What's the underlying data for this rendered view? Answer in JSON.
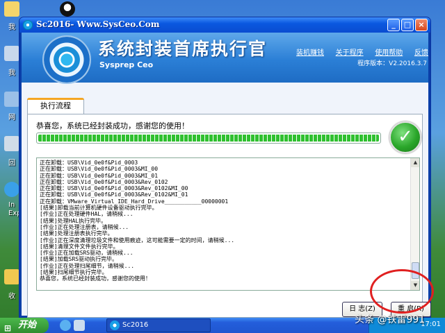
{
  "desktop": {
    "labels": [
      "我",
      "我",
      "网",
      "回",
      "In",
      "Exp",
      "收"
    ]
  },
  "window": {
    "title": "Sc2016- Www.SysCeo.Com",
    "minimize": "_",
    "maximize": "□",
    "close": "×"
  },
  "header": {
    "app_title": "系统封装首席执行官",
    "app_subtitle": "Sysprep Ceo",
    "links": [
      "装机赚钱",
      "关于程序",
      "使用帮助",
      "反馈"
    ],
    "version": "程序版本：V2.2016.3.7"
  },
  "tab": {
    "label": "执行流程"
  },
  "status": {
    "message": "恭喜您，系统已经封装成功，感谢您的使用！",
    "progress_percent": 100,
    "ok_icon": "check-icon"
  },
  "log": {
    "lines": [
      "正在卸载：USB\\Vid_0e0f&Pid_0003",
      "正在卸载：USB\\Vid_0e0f&Pid_0003&MI_00",
      "正在卸载：USB\\Vid_0e0f&Pid_0003&MI_01",
      "正在卸载：USB\\Vid_0e0f&Pid_0003&Rev_0102",
      "正在卸载：USB\\Vid_0e0f&Pid_0003&Rev_0102&MI_00",
      "正在卸载：USB\\Vid_0e0f&Pid_0003&Rev_0102&MI_01",
      "正在卸载：VMware_Virtual_IDE_Hard_Drive___________00000001",
      "[结果]卸载当前计算机硬件设备驱动执行完毕。",
      "[作业]正在处理硬件HAL，请稍候...",
      "[结果]处理HAL执行完毕。",
      "[作业]正在处理注册表，请稍候...",
      "[结果]处理注册表执行完毕。",
      "[作业]正在深度清理垃圾文件和使用痕迹，这可能需要一定的时间，请稍候...",
      "[结果]清理文件文件执行完毕。",
      "[作业]正在加载SRS驱动，请稍候...",
      "[结果]加载SRS驱动执行完毕。",
      "[作业]正在处理扫尾细节，请稍候...",
      "[结果]扫尾细节执行完毕。",
      "恭喜您，系统已经封装成功，感谢您的使用！"
    ]
  },
  "buttons": {
    "log": "日 志(Z)",
    "restart": "重 启(R)"
  },
  "taskbar": {
    "start": "开始",
    "task_title": "Sc2016",
    "clock": "17:01"
  },
  "watermark": "头条 @铁雷991"
}
